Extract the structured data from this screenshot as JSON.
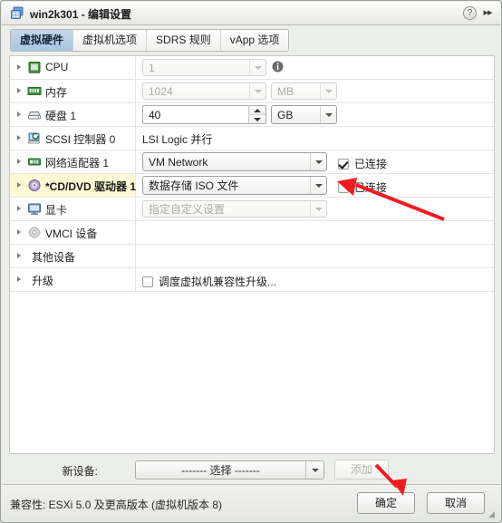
{
  "window": {
    "title": "win2k301 - 编辑设置",
    "app_icon": "vm-icon",
    "help_label": "?",
    "expand_label": "▸▸"
  },
  "tabs": [
    {
      "label": "虚拟硬件",
      "active": true
    },
    {
      "label": "虚拟机选项",
      "active": false
    },
    {
      "label": "SDRS 规则",
      "active": false
    },
    {
      "label": "vApp 选项",
      "active": false
    }
  ],
  "rows": [
    {
      "label": "CPU",
      "icon": "cpu-icon",
      "selected": false,
      "control": "combo",
      "value": "1",
      "disabled": true,
      "info_icon": "info-icon"
    },
    {
      "label": "内存",
      "icon": "memory-icon",
      "selected": false,
      "control": "combo-unit",
      "value": "1024",
      "unit": "MB",
      "disabled": true
    },
    {
      "label": "硬盘 1",
      "icon": "harddisk-icon",
      "selected": false,
      "control": "spin-unit",
      "value": "40",
      "unit": "GB",
      "disabled": false
    },
    {
      "label": "SCSI 控制器 0",
      "icon": "scsi-icon",
      "selected": false,
      "control": "text",
      "value": "LSI Logic 并行"
    },
    {
      "label": "网络适配器 1",
      "icon": "network-icon",
      "selected": false,
      "control": "combo-check",
      "value": "VM Network",
      "checkbox_label": "已连接",
      "checked": true,
      "disabled": false
    },
    {
      "label": "*CD/DVD 驱动器 1",
      "icon": "cddvd-icon",
      "selected": true,
      "control": "combo-check",
      "value": "数据存储 ISO 文件",
      "checkbox_label": "已连接",
      "checked": false,
      "disabled": false
    },
    {
      "label": "显卡",
      "icon": "videocard-icon",
      "selected": false,
      "control": "combo",
      "value": "指定自定义设置",
      "disabled": true
    },
    {
      "label": "VMCI 设备",
      "icon": "vmci-icon",
      "selected": false,
      "control": "none"
    },
    {
      "label": "其他设备",
      "icon": "none",
      "selected": false,
      "control": "none"
    },
    {
      "label": "升级",
      "icon": "none",
      "selected": false,
      "control": "checkbox",
      "checkbox_label": "调度虚拟机兼容性升级...",
      "checked": false
    }
  ],
  "new_device": {
    "label": "新设备:",
    "select_value": "------- 选择 -------",
    "add_label": "添加"
  },
  "footer": {
    "compatibility": "兼容性: ESXi 5.0 及更高版本 (虚拟机版本 8)",
    "ok_label": "确定",
    "cancel_label": "取消"
  },
  "annotations": {
    "arrow_color": "#ee1c22",
    "arrow1_target": "已连接 复选框",
    "arrow2_target": "确定 按钮"
  }
}
